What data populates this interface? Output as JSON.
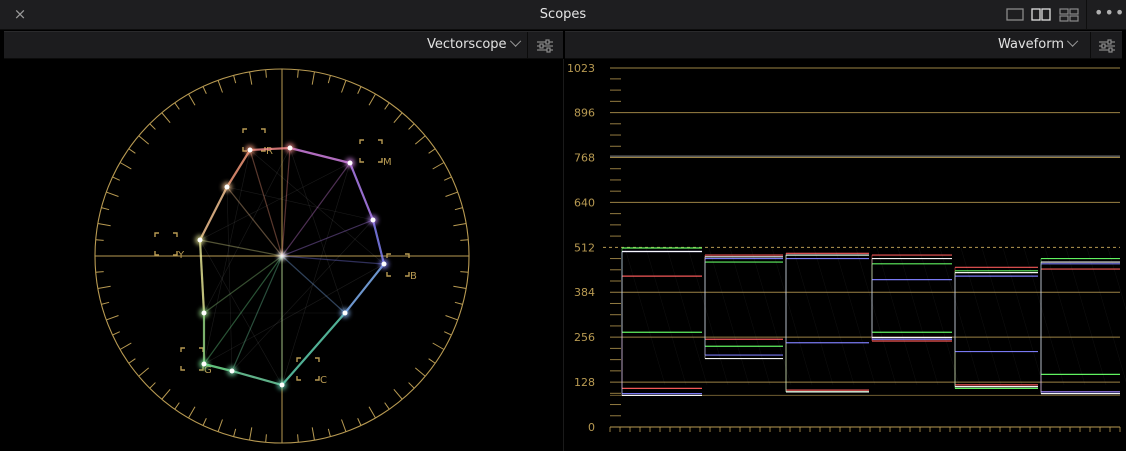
{
  "window": {
    "title": "Scopes",
    "close_icon": "×",
    "more_icon": "•••",
    "layouts": [
      "single-layout-icon",
      "dual-layout-icon",
      "quad-layout-icon"
    ],
    "active_layout": "dual-layout-icon"
  },
  "left_panel": {
    "scope": "Vectorscope",
    "targets": [
      "R",
      "M",
      "B",
      "C",
      "G",
      "Y"
    ]
  },
  "right_panel": {
    "scope": "Waveform",
    "y_scale": [
      "1023",
      "896",
      "768",
      "640",
      "512",
      "384",
      "256",
      "128",
      "0"
    ]
  },
  "colors": {
    "graticule": "#b89a52",
    "panel_bg": "#1c1c1e",
    "red_trace": "#ff5c5c",
    "green_trace": "#66ff66",
    "blue_trace": "#8080ff"
  }
}
